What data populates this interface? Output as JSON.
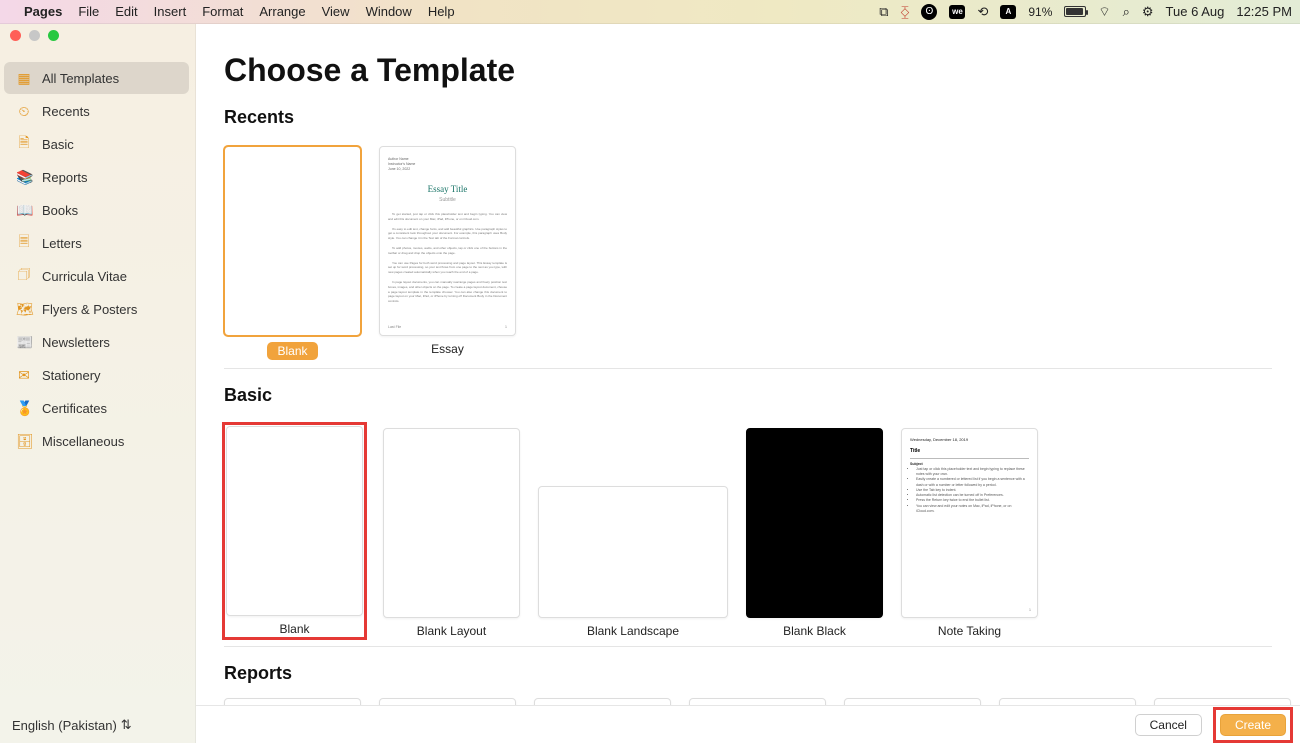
{
  "menubar": {
    "app_name": "Pages",
    "items": [
      "File",
      "Edit",
      "Insert",
      "Format",
      "Arrange",
      "View",
      "Window",
      "Help"
    ],
    "battery_pct": "91%",
    "date": "Tue 6 Aug",
    "time": "12:25 PM"
  },
  "sidebar": {
    "items": [
      {
        "label": "All Templates",
        "icon": "▦",
        "selected": true
      },
      {
        "label": "Recents",
        "icon": "⏲",
        "selected": false
      },
      {
        "label": "Basic",
        "icon": "🗎",
        "selected": false
      },
      {
        "label": "Reports",
        "icon": "📚",
        "selected": false
      },
      {
        "label": "Books",
        "icon": "📖",
        "selected": false
      },
      {
        "label": "Letters",
        "icon": "🗏",
        "selected": false
      },
      {
        "label": "Curricula Vitae",
        "icon": "🗇",
        "selected": false
      },
      {
        "label": "Flyers & Posters",
        "icon": "🗺",
        "selected": false
      },
      {
        "label": "Newsletters",
        "icon": "📰",
        "selected": false
      },
      {
        "label": "Stationery",
        "icon": "✉",
        "selected": false
      },
      {
        "label": "Certificates",
        "icon": "🏅",
        "selected": false
      },
      {
        "label": "Miscellaneous",
        "icon": "🗄",
        "selected": false
      }
    ],
    "language": "English (Pakistan)"
  },
  "main": {
    "title": "Choose a Template",
    "sections": {
      "recents": {
        "heading": "Recents",
        "templates": {
          "blank": "Blank",
          "essay": "Essay"
        },
        "essay_thumb": {
          "meta1": "Author Name",
          "meta2": "Instructor's Name",
          "meta3": "June 10, 2022",
          "title": "Essay Title",
          "subtitle": "Subtitle",
          "footer": "Last File",
          "page": "1"
        }
      },
      "basic": {
        "heading": "Basic",
        "templates": {
          "blank": "Blank",
          "blank_layout": "Blank Layout",
          "blank_landscape": "Blank Landscape",
          "blank_black": "Blank Black",
          "note_taking": "Note Taking"
        },
        "note_thumb": {
          "date": "Wednesday, December 18, 2019",
          "title": "Title",
          "subject": "Subject",
          "page": "1"
        }
      },
      "reports": {
        "heading": "Reports"
      }
    }
  },
  "footer": {
    "cancel": "Cancel",
    "create": "Create"
  },
  "colors": {
    "accent": "#f1a33c",
    "highlight": "#e53935"
  }
}
